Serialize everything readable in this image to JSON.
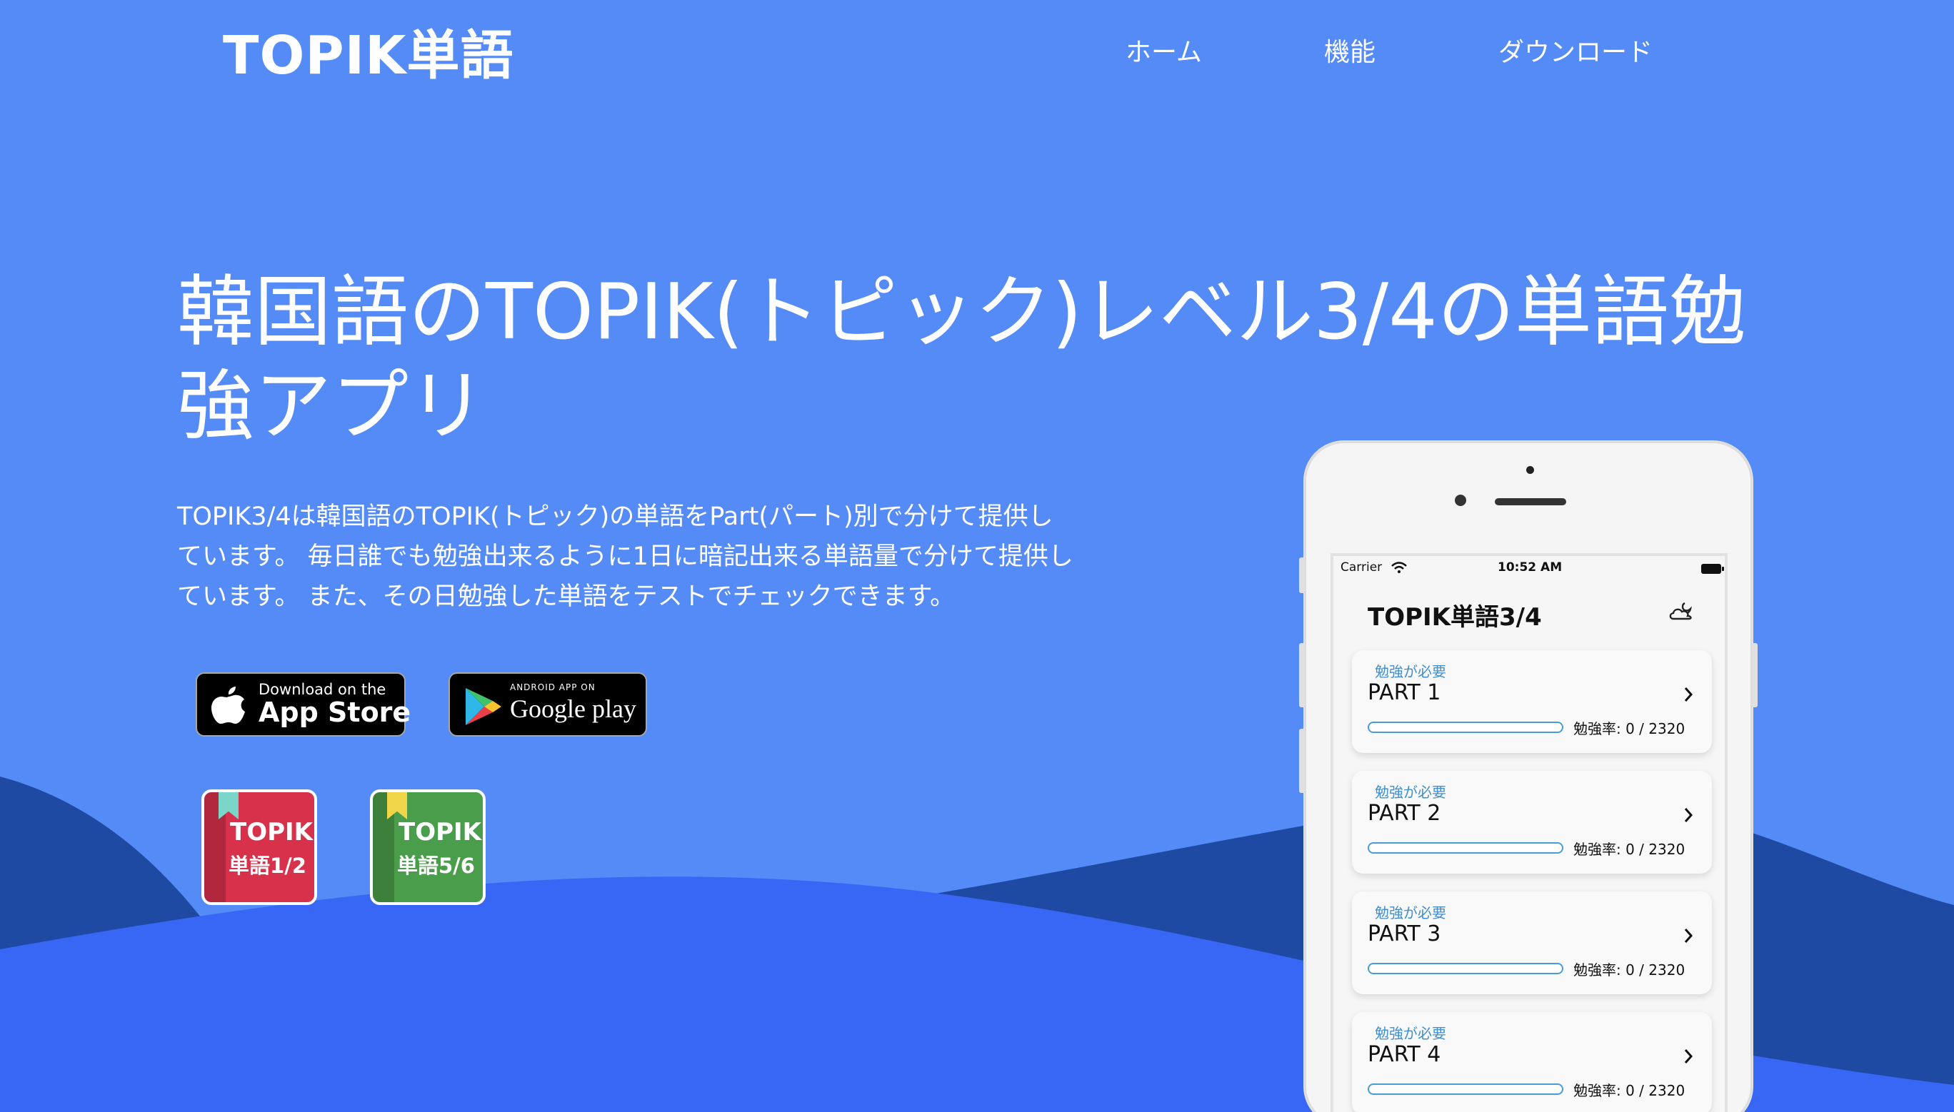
{
  "brand": {
    "name": "TOPIK単語"
  },
  "nav": {
    "items": [
      "ホーム",
      "機能",
      "ダウンロード"
    ]
  },
  "hero": {
    "title": "韓国語のTOPIK(トピック)レベル3/4の単語勉強アプリ",
    "description": "TOPIK3/4は韓国語のTOPIK(トピック)の単語をPart(パート)別で分けて提供しています。 毎日誰でも勉強出来るように1日に暗記出来る単語量で分けて提供しています。 また、その日勉強した単語をテストでチェックできます。"
  },
  "store_badges": {
    "appstore": {
      "small": "Download on the",
      "big": "App Store",
      "icon": "apple-icon"
    },
    "googleplay": {
      "small": "ANDROID APP ON",
      "big": "Google play",
      "icon": "google-play-icon"
    }
  },
  "related_apps": [
    {
      "line1": "TOPIK",
      "line2": "単語1/2",
      "color": "#d8314c",
      "ribbon": "#7ad6c8"
    },
    {
      "line1": "TOPIK",
      "line2": "単語5/6",
      "color": "#4a9d4a",
      "ribbon": "#f2d64a"
    }
  ],
  "phone": {
    "status": {
      "carrier": "Carrier",
      "time": "10:52 AM"
    },
    "app_title": "TOPIK単語3/4",
    "parts": [
      {
        "tag": "勉強が必要",
        "title": "PART 1",
        "rate": "勉強率: 0 / 2320",
        "progress": 0
      },
      {
        "tag": "勉強が必要",
        "title": "PART 2",
        "rate": "勉強率: 0 / 2320",
        "progress": 0
      },
      {
        "tag": "勉強が必要",
        "title": "PART 3",
        "rate": "勉強率: 0 / 2320",
        "progress": 0
      },
      {
        "tag": "勉強が必要",
        "title": "PART 4",
        "rate": "勉強率: 0 / 2320",
        "progress": 0
      }
    ]
  },
  "colors": {
    "background": "#548bf6",
    "wave_dark": "#1f4aa3",
    "wave_front": "#3867f5",
    "text": "#ffffff",
    "accent": "#4a9cd6"
  }
}
